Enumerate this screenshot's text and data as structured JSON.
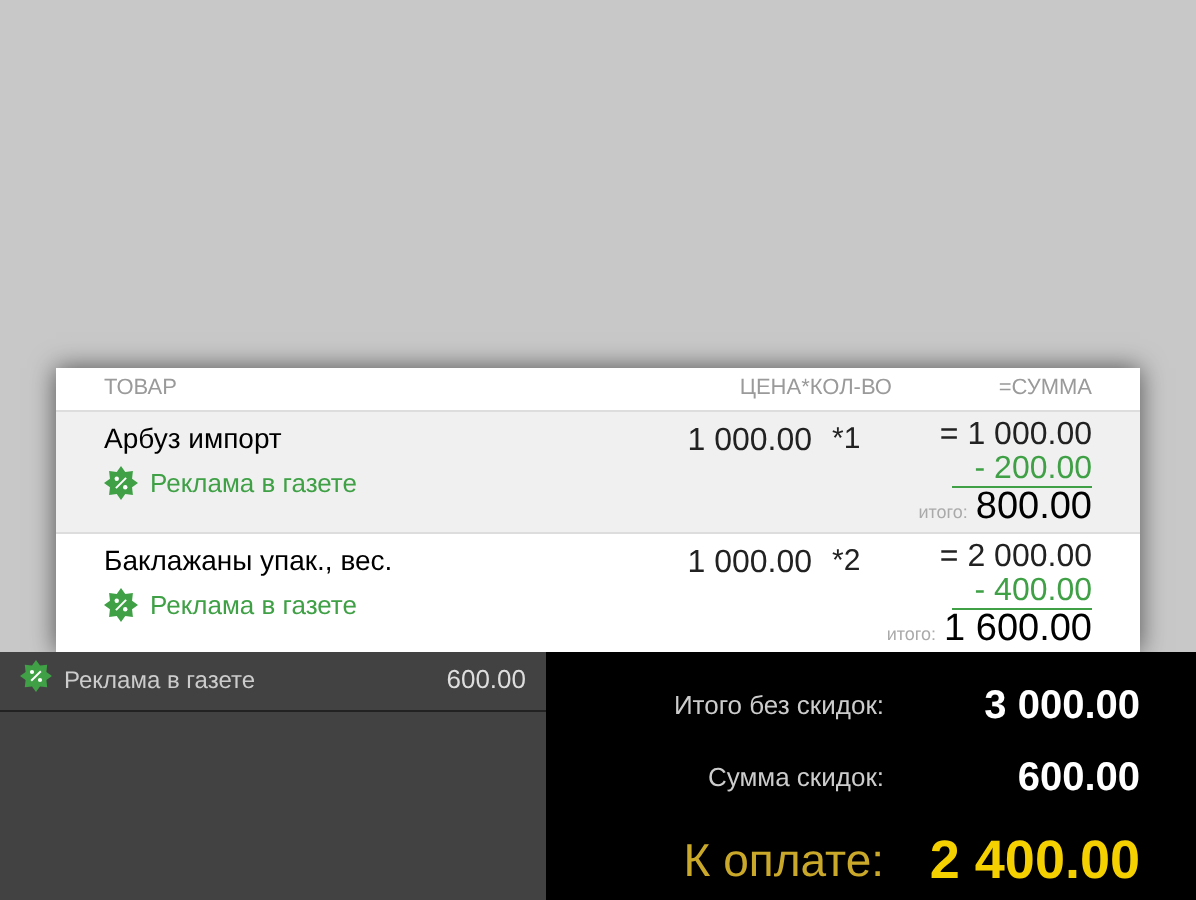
{
  "columns": [
    "ТОВАР",
    "ЦЕНА*КОЛ-ВО",
    "=СУММА"
  ],
  "items": [
    {
      "name": "Арбуз импорт",
      "discount": "Реклама в газете",
      "price": "1 000.00",
      "qty": "*1",
      "sum": "= 1 000.00",
      "minus": "- 200.00",
      "total_label": "итого:",
      "total": "800.00",
      "selected": true
    },
    {
      "name": "Баклажаны упак., вес.",
      "discount": "Реклама в газете",
      "price": "1 000.00",
      "qty": "*2",
      "sum": "= 2 000.00",
      "minus": "- 400.00",
      "total_label": "итого:",
      "total": "1 600.00",
      "selected": false
    }
  ],
  "discounts": [
    {
      "name": "Реклама в газете",
      "amount": "600.00"
    }
  ],
  "summary": {
    "subtotal_label": "Итого без скидок:",
    "subtotal": "3 000.00",
    "discount_label": "Сумма скидок:",
    "discount": "600.00",
    "pay_label": "К оплате:",
    "pay": "2 400.00"
  }
}
